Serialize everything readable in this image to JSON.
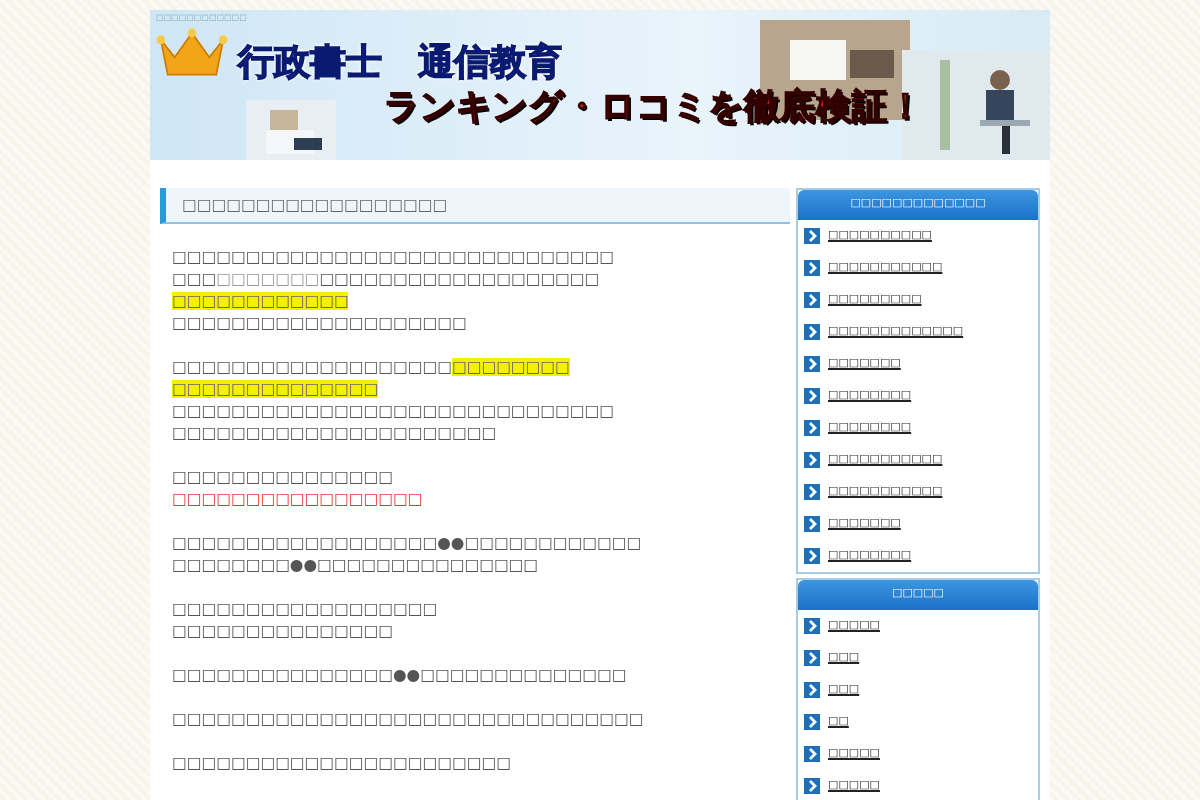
{
  "header": {
    "tagline": "□□□□□□□□□□□□",
    "title": "行政書士　通信教育",
    "subtitle": "ランキング・ロコミを徹底検証！"
  },
  "article": {
    "heading": "□□□□□□□□□□□□□□□□□□",
    "paragraphs": [
      [
        [
          {
            "kind": "plain",
            "text": "□□□□□□□□□□□□□□□□□□□□□□□□□□□□□□"
          }
        ],
        [
          {
            "kind": "plain",
            "text": "□□□"
          },
          {
            "kind": "faint",
            "text": "□□□□□□□"
          },
          {
            "kind": "plain",
            "text": "□□□□□□□□□□□□□□□□□□□"
          }
        ],
        [
          {
            "kind": "highlight",
            "text": "□□□□□□□□□□□□"
          }
        ],
        [
          {
            "kind": "plain",
            "text": "□□□□□□□□□□□□□□□□□□□□"
          }
        ]
      ],
      [
        [
          {
            "kind": "plain",
            "text": "□□□□□□□□□□□□□□□□□□□"
          },
          {
            "kind": "highlight",
            "text": "□□□□□□□□"
          }
        ],
        [
          {
            "kind": "highlight",
            "text": "□□□□□□□□□□□□□□"
          }
        ],
        [
          {
            "kind": "plain",
            "text": "□□□□□□□□□□□□□□□□□□□□□□□□□□□□□□"
          }
        ],
        [
          {
            "kind": "plain",
            "text": "□□□□□□□□□□□□□□□□□□□□□□"
          }
        ]
      ],
      [
        [
          {
            "kind": "plain",
            "text": "□□□□□□□□□□□□□□□"
          }
        ],
        [
          {
            "kind": "red",
            "text": "□□□□□□□□□□□□□□□□□"
          }
        ]
      ],
      [
        [
          {
            "kind": "plain",
            "text": "□□□□□□□□□□□□□□□□□□●●□□□□□□□□□□□□"
          }
        ],
        [
          {
            "kind": "plain",
            "text": "□□□□□□□□●●□□□□□□□□□□□□□□□"
          }
        ]
      ],
      [
        [
          {
            "kind": "plain",
            "text": "□□□□□□□□□□□□□□□□□□"
          }
        ],
        [
          {
            "kind": "plain",
            "text": "□□□□□□□□□□□□□□□"
          }
        ]
      ],
      [
        [
          {
            "kind": "plain",
            "text": "□□□□□□□□□□□□□□□●●□□□□□□□□□□□□□□"
          }
        ]
      ],
      [
        [
          {
            "kind": "plain",
            "text": "□□□□□□□□□□□□□□□□□□□□□□□□□□□□□□□□"
          }
        ]
      ],
      [
        [
          {
            "kind": "plain",
            "text": "□□□□□□□□□□□□□□□□□□□□□□□"
          }
        ]
      ]
    ]
  },
  "sidebar": [
    {
      "heading": "□□□□□□□□□□□□□",
      "items": [
        "□□□□□□□□□□",
        "□□□□□□□□□□□",
        "□□□□□□□□□",
        "□□□□□□□□□□□□□",
        "□□□□□□□",
        "□□□□□□□□",
        "□□□□□□□□",
        "□□□□□□□□□□□",
        "□□□□□□□□□□□",
        "□□□□□□□",
        "□□□□□□□□"
      ]
    },
    {
      "heading": "□□□□□",
      "items": [
        "□□□□□",
        "□□□",
        "□□□",
        "□□",
        "□□□□□",
        "□□□□□"
      ]
    }
  ]
}
